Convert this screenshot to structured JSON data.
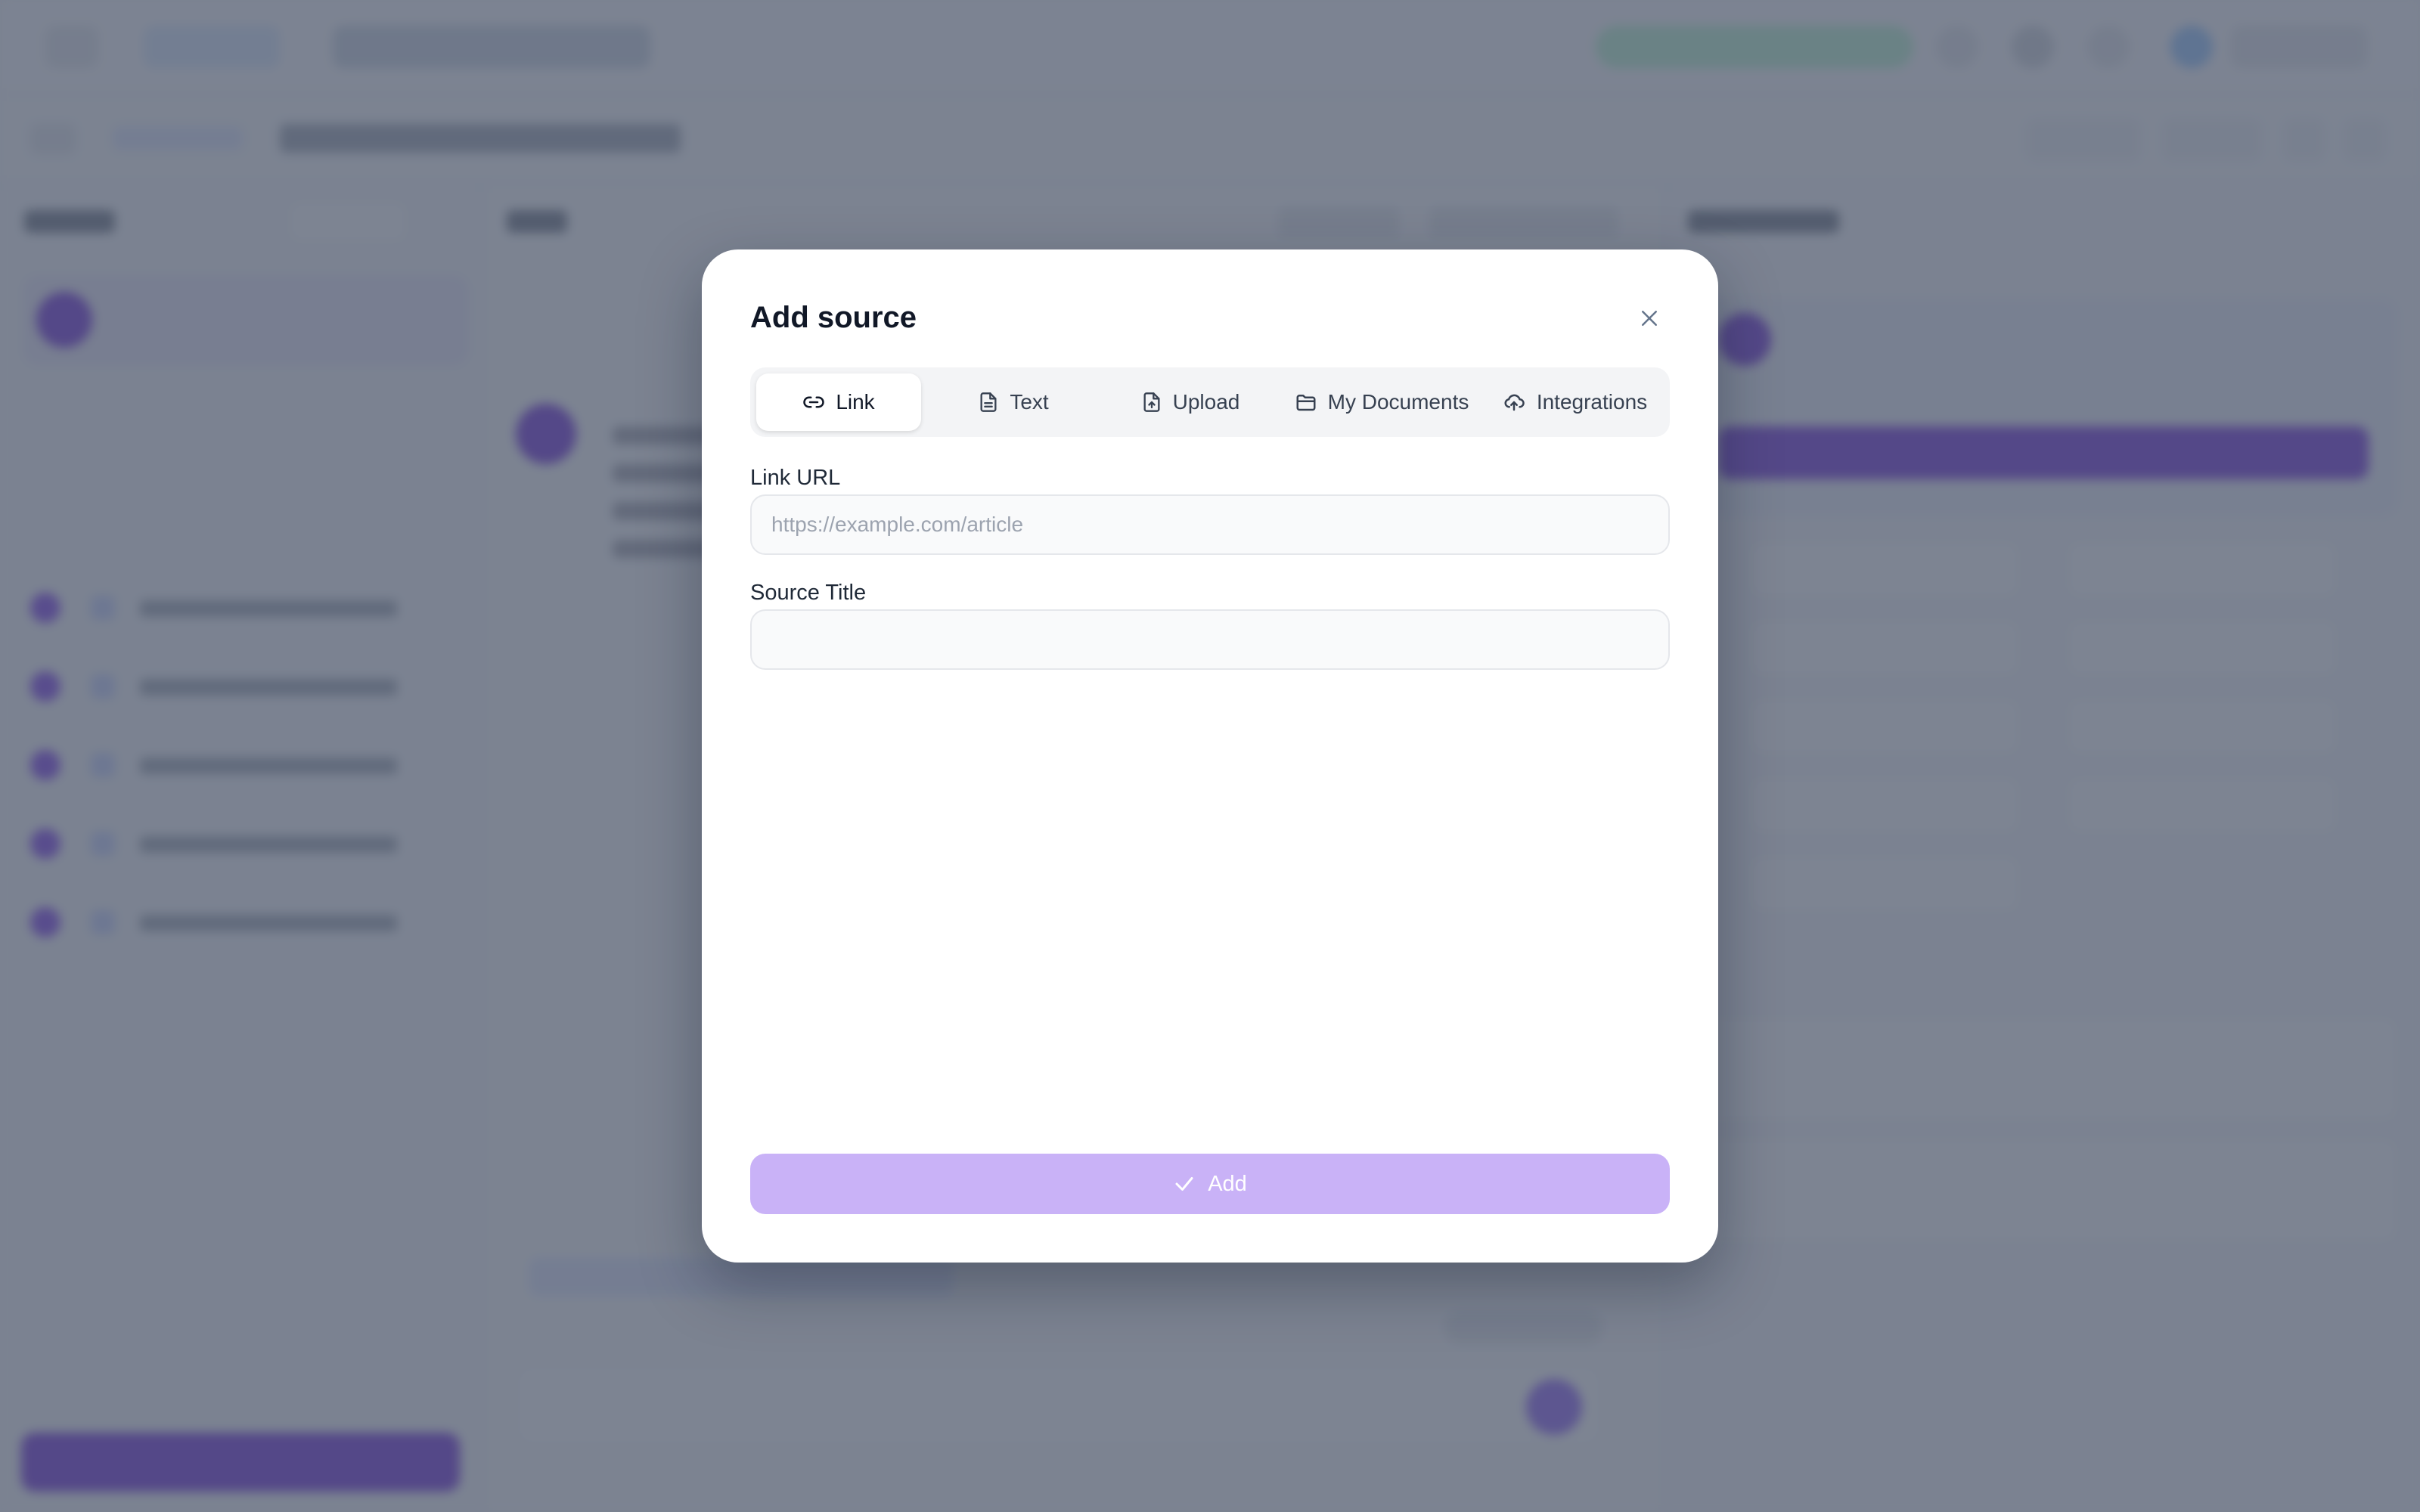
{
  "modal": {
    "title": "Add source",
    "tabs": [
      {
        "label": "Link",
        "icon": "link-icon",
        "active": true
      },
      {
        "label": "Text",
        "icon": "document-icon",
        "active": false
      },
      {
        "label": "Upload",
        "icon": "upload-file-icon",
        "active": false
      },
      {
        "label": "My Documents",
        "icon": "folder-icon",
        "active": false
      },
      {
        "label": "Integrations",
        "icon": "cloud-upload-icon",
        "active": false
      }
    ],
    "link_url": {
      "label": "Link URL",
      "placeholder": "https://example.com/article",
      "value": ""
    },
    "source_title": {
      "label": "Source Title",
      "placeholder": "",
      "value": ""
    },
    "add_button": {
      "label": "Add",
      "icon": "check-icon",
      "enabled": false
    }
  },
  "colors": {
    "accent": "#6d28d9",
    "add_button_disabled": "#c9b2f7",
    "scrim": "#4b5568"
  }
}
